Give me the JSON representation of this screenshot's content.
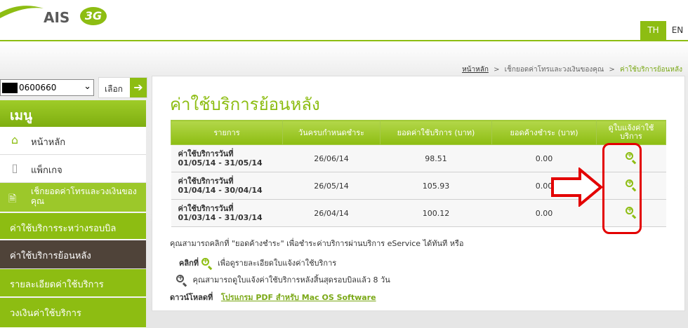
{
  "header": {
    "logo_text": "AIS",
    "logo_badge": "3G",
    "lang_th": "TH",
    "lang_en": "EN"
  },
  "breadcrumb": {
    "home": "หน้าหลัก",
    "section": "เช็กยอดค่าโทรและวงเงินของคุณ",
    "current": "ค่าใช้บริการย้อนหลัง",
    "separator": ">"
  },
  "number_select": {
    "value": "0600660",
    "choose_label": "เลือก"
  },
  "sidebar": {
    "menu_title": "เมนู",
    "items": [
      {
        "label": "หน้าหลัก",
        "icon": "home-icon"
      },
      {
        "label": "แพ็กเกจ",
        "icon": "phone-icon"
      },
      {
        "label": "เช็กยอดค่าโทรและวงเงินของคุณ",
        "icon": "bill-icon"
      },
      {
        "label": "ค่าใช้บริการระหว่างรอบบิล"
      },
      {
        "label": "ค่าใช้บริการย้อนหลัง"
      },
      {
        "label": "รายละเอียดค่าใช้บริการ"
      },
      {
        "label": "วงเงินค่าใช้บริการ"
      }
    ]
  },
  "main": {
    "title": "ค่าใช้บริการย้อนหลัง",
    "columns": [
      "รายการ",
      "วันครบกำหนดชำระ",
      "ยอดค่าใช้บริการ (บาท)",
      "ยอดค้างชำระ (บาท)",
      "ดูใบแจ้งค่าใช้บริการ"
    ],
    "rows": [
      {
        "line1": "ค่าใช้บริการวันที่",
        "line2": "01/05/14 - 31/05/14",
        "due": "26/06/14",
        "amount": "98.51",
        "outstanding": "0.00"
      },
      {
        "line1": "ค่าใช้บริการวันที่",
        "line2": "01/04/14 - 30/04/14",
        "due": "26/05/14",
        "amount": "105.93",
        "outstanding": "0.00"
      },
      {
        "line1": "ค่าใช้บริการวันที่",
        "line2": "01/03/14 - 31/03/14",
        "due": "26/04/14",
        "amount": "100.12",
        "outstanding": "0.00"
      }
    ],
    "note_pay": "คุณสามารถคลิกที่ \"ยอดค้างชำระ\" เพื่อชำระค่าบริการผ่านบริการ eService ได้ทันที หรือ",
    "note_click_prefix": "คลิกที่",
    "note_click_text": "เพื่อดูรายละเอียดใบแจ้งค่าใช้บริการ",
    "note_view": "คุณสามารถดูใบแจ้งค่าใช้บริการหลังสิ้นสุดรอบบิลแล้ว 8 วัน",
    "download_label": "ดาวน์โหลดที่",
    "download_link": "โปรแกรม PDF สำหรับ Mac OS Software"
  },
  "colors": {
    "brand_green": "#8dbd12",
    "sidebar_active": "#4f4339",
    "highlight_red": "#e30000"
  }
}
